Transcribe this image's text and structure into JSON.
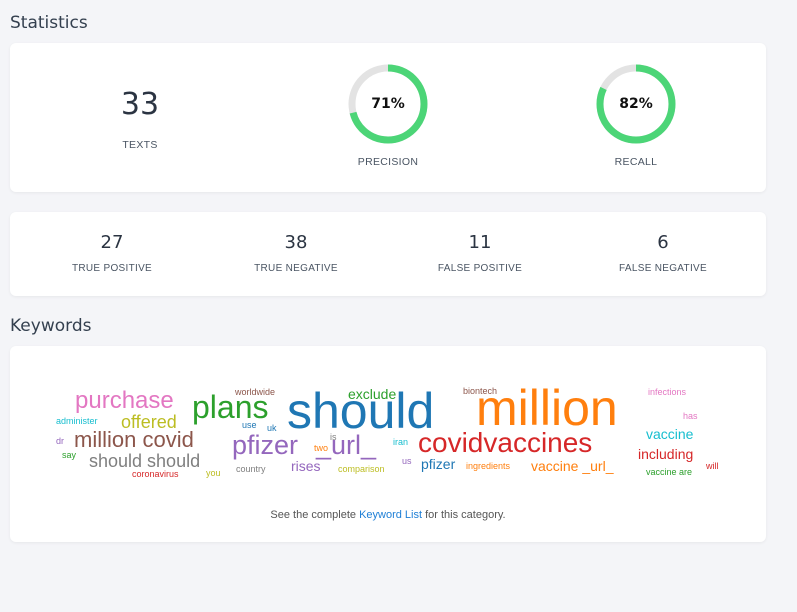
{
  "statistics": {
    "title": "Statistics",
    "texts": {
      "value": "33",
      "label": "TEXTS"
    },
    "precision": {
      "value": "71%",
      "label": "PRECISION",
      "fraction": 0.71
    },
    "recall": {
      "value": "82%",
      "label": "RECALL",
      "fraction": 0.82
    },
    "ring_color": "#4cd577",
    "ring_track_color": "#e3e3e3"
  },
  "confusion": [
    {
      "value": "27",
      "label": "TRUE POSITIVE"
    },
    {
      "value": "38",
      "label": "TRUE NEGATIVE"
    },
    {
      "value": "11",
      "label": "FALSE POSITIVE"
    },
    {
      "value": "6",
      "label": "FALSE NEGATIVE"
    }
  ],
  "keywords": {
    "title": "Keywords",
    "words": [
      {
        "text": "should",
        "color": "#1f77b4"
      },
      {
        "text": "million",
        "color": "#ff7f0e"
      },
      {
        "text": "plans",
        "color": "#2ca02c"
      },
      {
        "text": "purchase",
        "color": "#e377c2"
      },
      {
        "text": "covidvaccines",
        "color": "#d62728"
      },
      {
        "text": "pfizer",
        "color": "#9467bd"
      },
      {
        "text": "_url_",
        "color": "#9467bd"
      },
      {
        "text": "million covid",
        "color": "#8c564b"
      },
      {
        "text": "should should",
        "color": "#7f7f7f"
      },
      {
        "text": "offered",
        "color": "#bcbd22"
      },
      {
        "text": "exclude",
        "color": "#2ca02c"
      },
      {
        "text": "vaccine",
        "color": "#17becf"
      },
      {
        "text": "including",
        "color": "#d62728"
      },
      {
        "text": "vaccine _url_",
        "color": "#ff7f0e"
      },
      {
        "text": "pfizer",
        "color": "#1f77b4"
      },
      {
        "text": "rises",
        "color": "#9467bd"
      },
      {
        "text": "worldwide",
        "color": "#8c564b"
      },
      {
        "text": "biontech",
        "color": "#8c564b"
      },
      {
        "text": "infections",
        "color": "#e377c2"
      },
      {
        "text": "has",
        "color": "#e377c2"
      },
      {
        "text": "administer",
        "color": "#17becf"
      },
      {
        "text": "use",
        "color": "#1f77b4"
      },
      {
        "text": "uk",
        "color": "#1f77b4"
      },
      {
        "text": "is",
        "color": "#7f7f7f"
      },
      {
        "text": "two",
        "color": "#ff7f0e"
      },
      {
        "text": "iran",
        "color": "#17becf"
      },
      {
        "text": "us",
        "color": "#9467bd"
      },
      {
        "text": "ingredients",
        "color": "#ff7f0e"
      },
      {
        "text": "dr",
        "color": "#9467bd"
      },
      {
        "text": "say",
        "color": "#2ca02c"
      },
      {
        "text": "coronavirus",
        "color": "#d62728"
      },
      {
        "text": "you",
        "color": "#bcbd22"
      },
      {
        "text": "country",
        "color": "#7f7f7f"
      },
      {
        "text": "comparison",
        "color": "#bcbd22"
      },
      {
        "text": "vaccine are",
        "color": "#2ca02c"
      },
      {
        "text": "will",
        "color": "#d62728"
      }
    ],
    "footer_before": "See the complete ",
    "footer_link": "Keyword List",
    "footer_after": " for this category."
  }
}
